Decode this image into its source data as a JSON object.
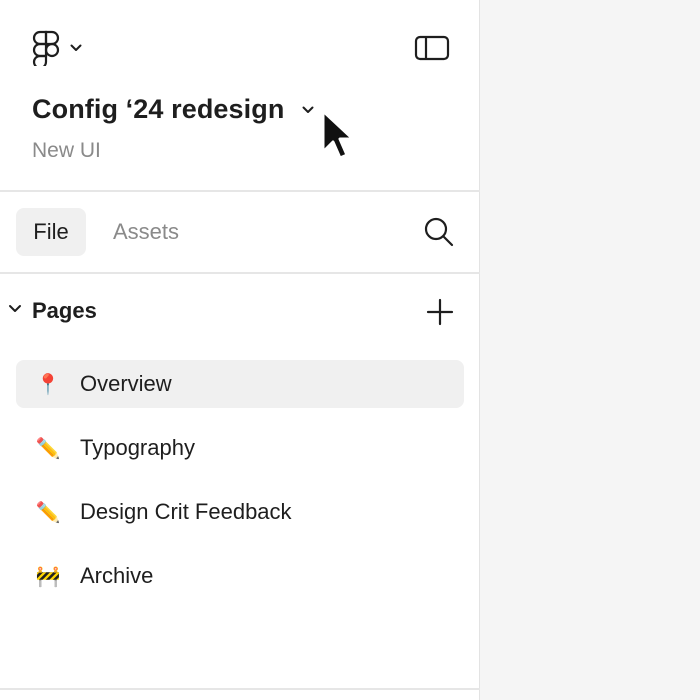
{
  "header": {
    "logo_icon": "figma-logo-icon",
    "menu_chevron_icon": "chevron-down-icon",
    "sidebar_toggle_icon": "sidebar-toggle-icon",
    "file_title": "Config ‘24 redesign",
    "project_name": "New UI"
  },
  "tabs": [
    {
      "label": "File",
      "active": true
    },
    {
      "label": "Assets",
      "active": false
    }
  ],
  "search": {
    "icon": "search-icon"
  },
  "pages_section": {
    "label": "Pages",
    "collapse_icon": "chevron-down-icon",
    "add_icon": "plus-icon",
    "items": [
      {
        "emoji": "📍",
        "label": "Overview",
        "selected": true
      },
      {
        "emoji": "✏️",
        "label": "Typography",
        "selected": false
      },
      {
        "emoji": "✏️",
        "label": "Design Crit Feedback",
        "selected": false
      },
      {
        "emoji": "🚧",
        "label": "Archive",
        "selected": false
      }
    ]
  },
  "colors": {
    "panel_bg": "#ffffff",
    "canvas_bg": "#f5f5f5",
    "selected_bg": "#f0f0f0",
    "text_primary": "#1e1e1e",
    "text_secondary": "#8a8a8a"
  }
}
